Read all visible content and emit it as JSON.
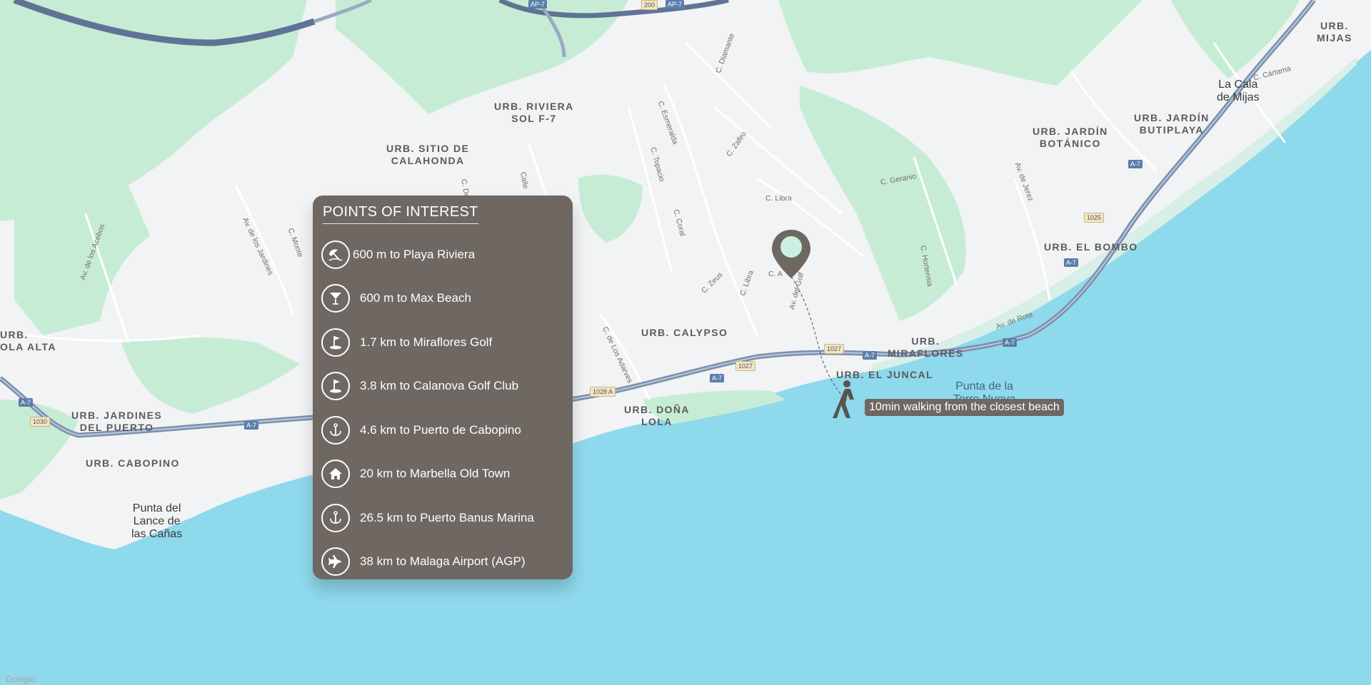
{
  "colors": {
    "sea": "#8ed9ec",
    "land": "#f1f3f4",
    "green": "#c7ecd6",
    "highway": "#7c90ad",
    "panel": "#6e6762",
    "pin": "#6e6762",
    "pin_dot": "#c9f0e0"
  },
  "poi_panel": {
    "title": "POINTS OF INTEREST",
    "items": [
      {
        "icon": "beach-umbrella-icon",
        "label": "600 m to Playa Riviera"
      },
      {
        "icon": "cocktail-glass-icon",
        "label": "600 m to Max Beach"
      },
      {
        "icon": "golf-flag-icon",
        "label": "1.7 km to Miraflores Golf"
      },
      {
        "icon": "golf-flag-icon",
        "label": "3.8 km to Calanova Golf Club"
      },
      {
        "icon": "anchor-icon",
        "label": "4.6 km to Puerto de Cabopino"
      },
      {
        "icon": "house-icon",
        "label": "20 km to Marbella Old Town"
      },
      {
        "icon": "anchor-icon",
        "label": "26.5 km to Puerto Banus Marina"
      },
      {
        "icon": "airplane-icon",
        "label": "38 km to Malaga Airport (AGP)"
      }
    ]
  },
  "walking": {
    "icon": "walking-person-icon",
    "label": "10min walking from the closest beach"
  },
  "map_labels": {
    "urb_riviera": "URB. RIVIERA\nSOL F-7",
    "urb_sitio": "URB. SITIO DE\nCALAHONDA",
    "urb_calypso": "URB. CALYPSO",
    "urb_dona_lola": "URB. DOÑA\nLOLA",
    "urb_jardines": "URB. JARDINES\nDEL PUERTO",
    "urb_cabopino": "URB. CABOPINO",
    "urb_ola_alta": "URB.\nOLA ALTA",
    "urb_el_juncal": "URB. EL JUNCAL",
    "urb_miraflores": "URB.\nMIRAFLORES",
    "urb_el_bombo": "URB. EL BOMBO",
    "urb_jardin_botanico": "URB. JARDÍN\nBOTÁNICO",
    "urb_jardin_butiplaya": "URB. JARDÍN\nBUTIPLAYA",
    "urb_mijas": "URB.\nMIJAS",
    "la_cala": "La Cala\nde Mijas",
    "punta_lance": "Punta del\nLance de\nlas Cañas",
    "punta_torre": "Punta de la\nTorre Nueva",
    "google": "Google"
  },
  "streets": [
    {
      "t": "C. Diamante"
    },
    {
      "t": "C. Esmeralda"
    },
    {
      "t": "C. Zafiro"
    },
    {
      "t": "C. Topacio"
    },
    {
      "t": "C. Libra"
    },
    {
      "t": "C. Geranio"
    },
    {
      "t": "C. Coral"
    },
    {
      "t": "C. Zeus"
    },
    {
      "t": "C. Libra"
    },
    {
      "t": "Av. del Golf"
    },
    {
      "t": "C. Hortensia"
    },
    {
      "t": "Av. de Rota"
    },
    {
      "t": "Av. de Jerez"
    },
    {
      "t": "C. Cártama"
    },
    {
      "t": "C. de Los Adarves"
    },
    {
      "t": "Av. de los Acebos"
    },
    {
      "t": "Av. de los Jardines"
    },
    {
      "t": "C. Monte"
    },
    {
      "t": "C. Do"
    },
    {
      "t": "Calle"
    },
    {
      "t": "C. A"
    }
  ],
  "road_shields": {
    "ap7_a": "AP-7",
    "ap7_b": "AP-7",
    "n200": "200",
    "a7_1": "A-7",
    "a7_2": "A-7",
    "a7_3": "A-7",
    "a7_4": "A-7",
    "a7_5": "A-7",
    "a7_6": "A-7",
    "a7_7": "A-7",
    "r1030": "1030",
    "r1028": "1028 A",
    "r1027a": "1027",
    "r1027b": "1027",
    "r1025": "1025"
  }
}
